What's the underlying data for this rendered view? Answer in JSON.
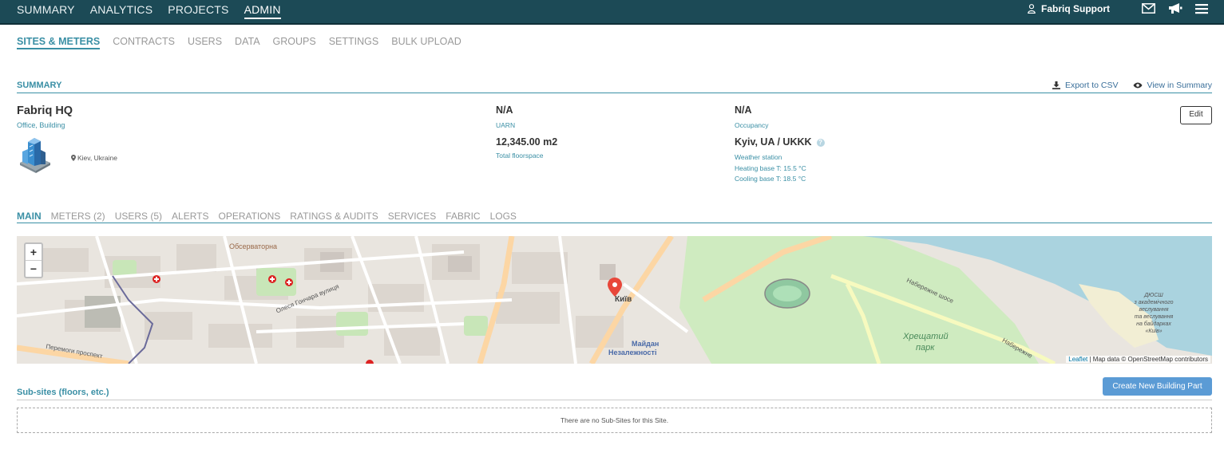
{
  "topnav": {
    "items": [
      "SUMMARY",
      "ANALYTICS",
      "PROJECTS",
      "ADMIN"
    ],
    "active": "ADMIN"
  },
  "user": {
    "name": "Fabriq Support",
    "icon": "user-icon"
  },
  "header_icons": [
    "mail-icon",
    "megaphone-icon",
    "hamburger-menu-icon"
  ],
  "subnav": {
    "items": [
      "SITES & METERS",
      "CONTRACTS",
      "USERS",
      "DATA",
      "GROUPS",
      "SETTINGS",
      "BULK UPLOAD"
    ],
    "active": "SITES & METERS"
  },
  "summary": {
    "title": "SUMMARY",
    "export_label": "Export to CSV",
    "view_label": "View in Summary"
  },
  "site": {
    "name": "Fabriq HQ",
    "type": "Office, Building",
    "location": "Kiev, Ukraine",
    "uarn_value": "N/A",
    "uarn_label": "UARN",
    "floorspace_value": "12,345.00 m2",
    "floorspace_label": "Total floorspace",
    "occupancy_value": "N/A",
    "occupancy_label": "Occupancy",
    "weather_value": "Kyiv, UA / UKKK",
    "weather_label": "Weather station",
    "heating": "Heating base T: 15.5 °C",
    "cooling": "Cooling base T: 18.5 °C",
    "edit_label": "Edit"
  },
  "tabs": {
    "items": [
      "MAIN",
      "METERS (2)",
      "USERS (5)",
      "ALERTS",
      "OPERATIONS",
      "RATINGS & AUDITS",
      "SERVICES",
      "FABRIC",
      "LOGS"
    ],
    "active": "MAIN"
  },
  "map": {
    "zoom_in": "+",
    "zoom_out": "−",
    "labels": {
      "kyiv": "Київ",
      "maidan1": "Майдан",
      "maidan2": "Незалежності",
      "observatory": "Обсерваторна",
      "khreshchatyi1": "Хрещатий",
      "khreshchatyi2": "парк",
      "naberezhne": "Набережне шосе",
      "naberezhne2": "Набережне",
      "peremohy": "Перемоги проспект",
      "honchara": "Олеся Гончара вулиця",
      "dyusch1": "ДЮСШ",
      "dyusch2": "з академічного",
      "dyusch3": "веслування",
      "dyusch4": "та веслування",
      "dyusch5": "на байдарках",
      "dyusch6": "«Київ»"
    },
    "attrib_link": "Leaflet",
    "attrib_text": " | Map data © OpenStreetMap contributors"
  },
  "subsites": {
    "title": "Sub-sites (floors, etc.)",
    "create_label": "Create New Building Part",
    "empty_text": "There are no Sub-Sites for this Site."
  }
}
